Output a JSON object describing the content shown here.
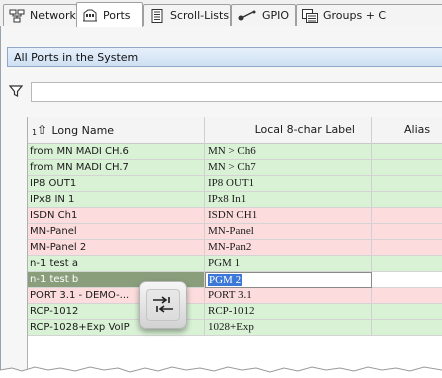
{
  "tabs": [
    {
      "label": "Network",
      "icon": "network-icon"
    },
    {
      "label": "Ports",
      "icon": "ports-icon"
    },
    {
      "label": "Scroll-Lists",
      "icon": "scroll-list-icon"
    },
    {
      "label": "GPIO",
      "icon": "gpio-icon"
    },
    {
      "label": "Groups + C",
      "icon": "groups-icon"
    }
  ],
  "active_tab": "Ports",
  "port_selector": {
    "value": "All Ports in the System"
  },
  "filter": {
    "icon": "filter-icon",
    "value": ""
  },
  "table": {
    "sort": {
      "priority": "1",
      "icon": "sort-ascending-icon"
    },
    "headers": {
      "long_name": "Long Name",
      "label": "Local 8-char Label",
      "alias": "Alias"
    },
    "rows": [
      {
        "long_name": "from MN MADI CH.6",
        "label": "MN > Ch6",
        "color": "green"
      },
      {
        "long_name": "from MN MADI CH.7",
        "label": "MN > Ch7",
        "color": "green"
      },
      {
        "long_name": "IP8 OUT1",
        "label": "IP8 OUT1",
        "color": "green"
      },
      {
        "long_name": "IPx8 IN 1",
        "label": "IPx8 In1",
        "color": "green"
      },
      {
        "long_name": "ISDN Ch1",
        "label": "ISDN CH1",
        "color": "pink"
      },
      {
        "long_name": "MN-Panel",
        "label": "MN-Panel",
        "color": "pink"
      },
      {
        "long_name": "MN-Panel 2",
        "label": "MN-Pan2",
        "color": "pink"
      },
      {
        "long_name": "n-1 test a",
        "label": "PGM 1",
        "color": "green"
      },
      {
        "long_name": "n-1 test b",
        "label": "PGM 2",
        "color": "selected",
        "editing": true
      },
      {
        "long_name": "PORT 3.1 - DEMO-...",
        "label": "PORT 3.1",
        "color": "pink"
      },
      {
        "long_name": "RCP-1012",
        "label": "RCP-1012",
        "color": "green"
      },
      {
        "long_name": "RCP-1028+Exp VoIP",
        "label": "1028+Exp",
        "color": "green"
      }
    ]
  },
  "overlay": {
    "key_icon": "tab-key-icon"
  },
  "colors": {
    "green_row": "#d9f2d5",
    "pink_row": "#fcdcdc",
    "selected_row": "#8a9e7c",
    "edit_highlight": "#3b78d8",
    "selector_bar": "#cfe0f3"
  }
}
